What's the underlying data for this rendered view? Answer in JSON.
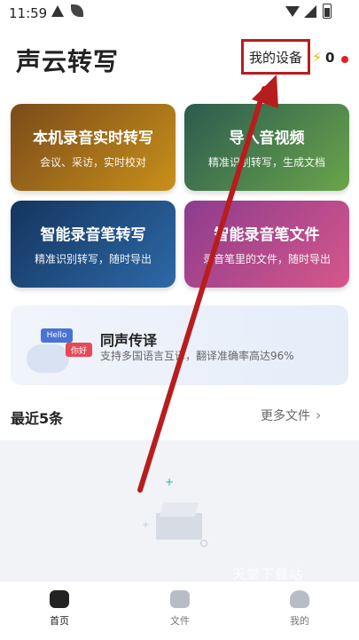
{
  "status": {
    "time": "11:59"
  },
  "header": {
    "title": "声云转写",
    "device_button": "我的设备",
    "energy_count": "0"
  },
  "cards": [
    {
      "title": "本机录音实时转写",
      "subtitle": "会议、采访，实时校对"
    },
    {
      "title": "导入音视频",
      "subtitle": "精准识别转写，生成文档"
    },
    {
      "title": "智能录音笔转写",
      "subtitle": "精准识别转写，随时导出"
    },
    {
      "title": "智能录音笔文件",
      "subtitle": "录音笔里的文件，随时导出"
    }
  ],
  "translate": {
    "title": "同声传译",
    "subtitle": "支持多国语言互译，翻译准确率高达96%",
    "bubble_en": "Hello",
    "bubble_zh": "你好"
  },
  "recent": {
    "title": "最近5条",
    "more": "更多文件"
  },
  "watermark": "天堂下载站",
  "nav": [
    {
      "label": "首页"
    },
    {
      "label": "文件"
    },
    {
      "label": "我的"
    }
  ],
  "colors": {
    "highlight": "#b81d1d",
    "accent": "#f4b400"
  }
}
